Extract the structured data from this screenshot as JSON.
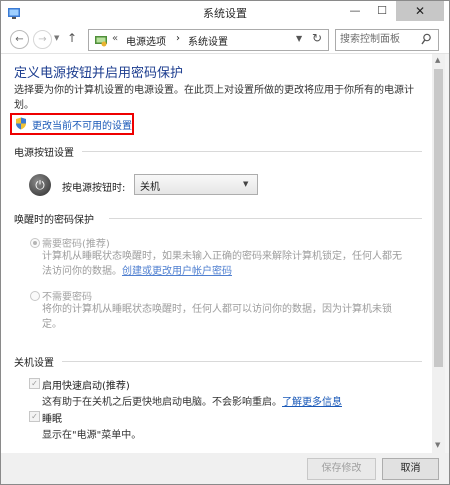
{
  "window": {
    "title": "系统设置",
    "minimize_glyph": "—",
    "maximize_glyph": "☐",
    "close_glyph": "✕"
  },
  "nav": {
    "back_glyph": "←",
    "forward_glyph": "→",
    "up_glyph": "↑",
    "breadcrumb_prefix": "«",
    "breadcrumb": [
      "电源选项",
      "系统设置"
    ],
    "breadcrumb_sep": "›",
    "refresh_glyph": "↻",
    "search_placeholder": "搜索控制面板"
  },
  "main": {
    "heading": "定义电源按钮并启用密码保护",
    "description": "选择要为你的计算机设置的电源设置。在此页上对设置所做的更改将应用于你所有的电源计划。",
    "change_link": "更改当前不可用的设置",
    "power_section": {
      "title": "电源按钮设置",
      "button_label": "按电源按钮时:",
      "selected_value": "关机"
    },
    "wake_section": {
      "title": "唤醒时的密码保护",
      "options": [
        {
          "label": "需要密码(推荐)",
          "selected": true,
          "desc_line1": "计算机从睡眠状态唤醒时，如果未输入正确的密码来解除计算机锁定，任何人都无",
          "desc_line2_prefix": "法访问你的数据。",
          "desc_link": "创建或更改用户帐户密码"
        },
        {
          "label": "不需要密码",
          "selected": false,
          "desc_line1": "将你的计算机从睡眠状态唤醒时，任何人都可以访问你的数据，因为计算机未锁",
          "desc_line2": "定。"
        }
      ]
    },
    "shutdown_section": {
      "title": "关机设置",
      "options": [
        {
          "label": "启用快速启动(推荐)",
          "checked": true,
          "desc": "这有助于在关机之后更快地启动电脑。不会影响重启。",
          "desc_link": "了解更多信息"
        },
        {
          "label": "睡眠",
          "checked": true,
          "desc": "显示在\"电源\"菜单中。"
        }
      ]
    }
  },
  "footer": {
    "save_label": "保存修改",
    "cancel_label": "取消"
  },
  "colors": {
    "heading": "#1c3d8f",
    "link": "#1a59b8",
    "highlight_box": "#ee0000"
  }
}
